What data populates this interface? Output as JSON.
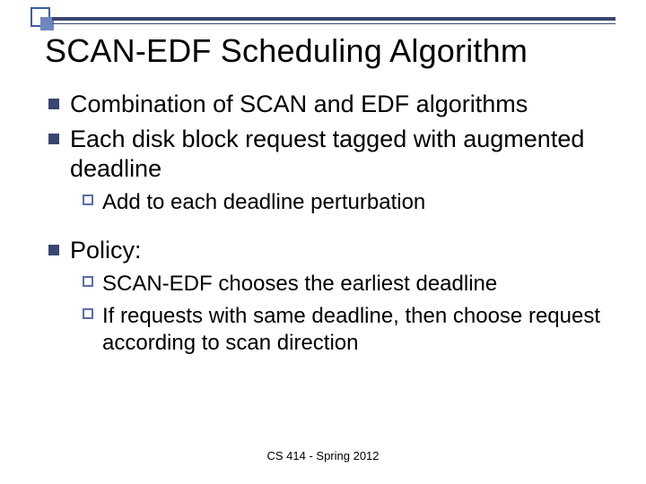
{
  "title": "SCAN-EDF Scheduling Algorithm",
  "bullets": {
    "b1_1": "Combination of SCAN and EDF algorithms",
    "b1_2": "Each disk block request tagged with augmented deadline",
    "b2_1": "Add to each deadline perturbation",
    "b1_3": "Policy:",
    "b2_2": "SCAN-EDF chooses the earliest deadline",
    "b2_3": "If requests with same deadline, then choose request according to scan direction"
  },
  "footer": "CS 414 - Spring 2012"
}
